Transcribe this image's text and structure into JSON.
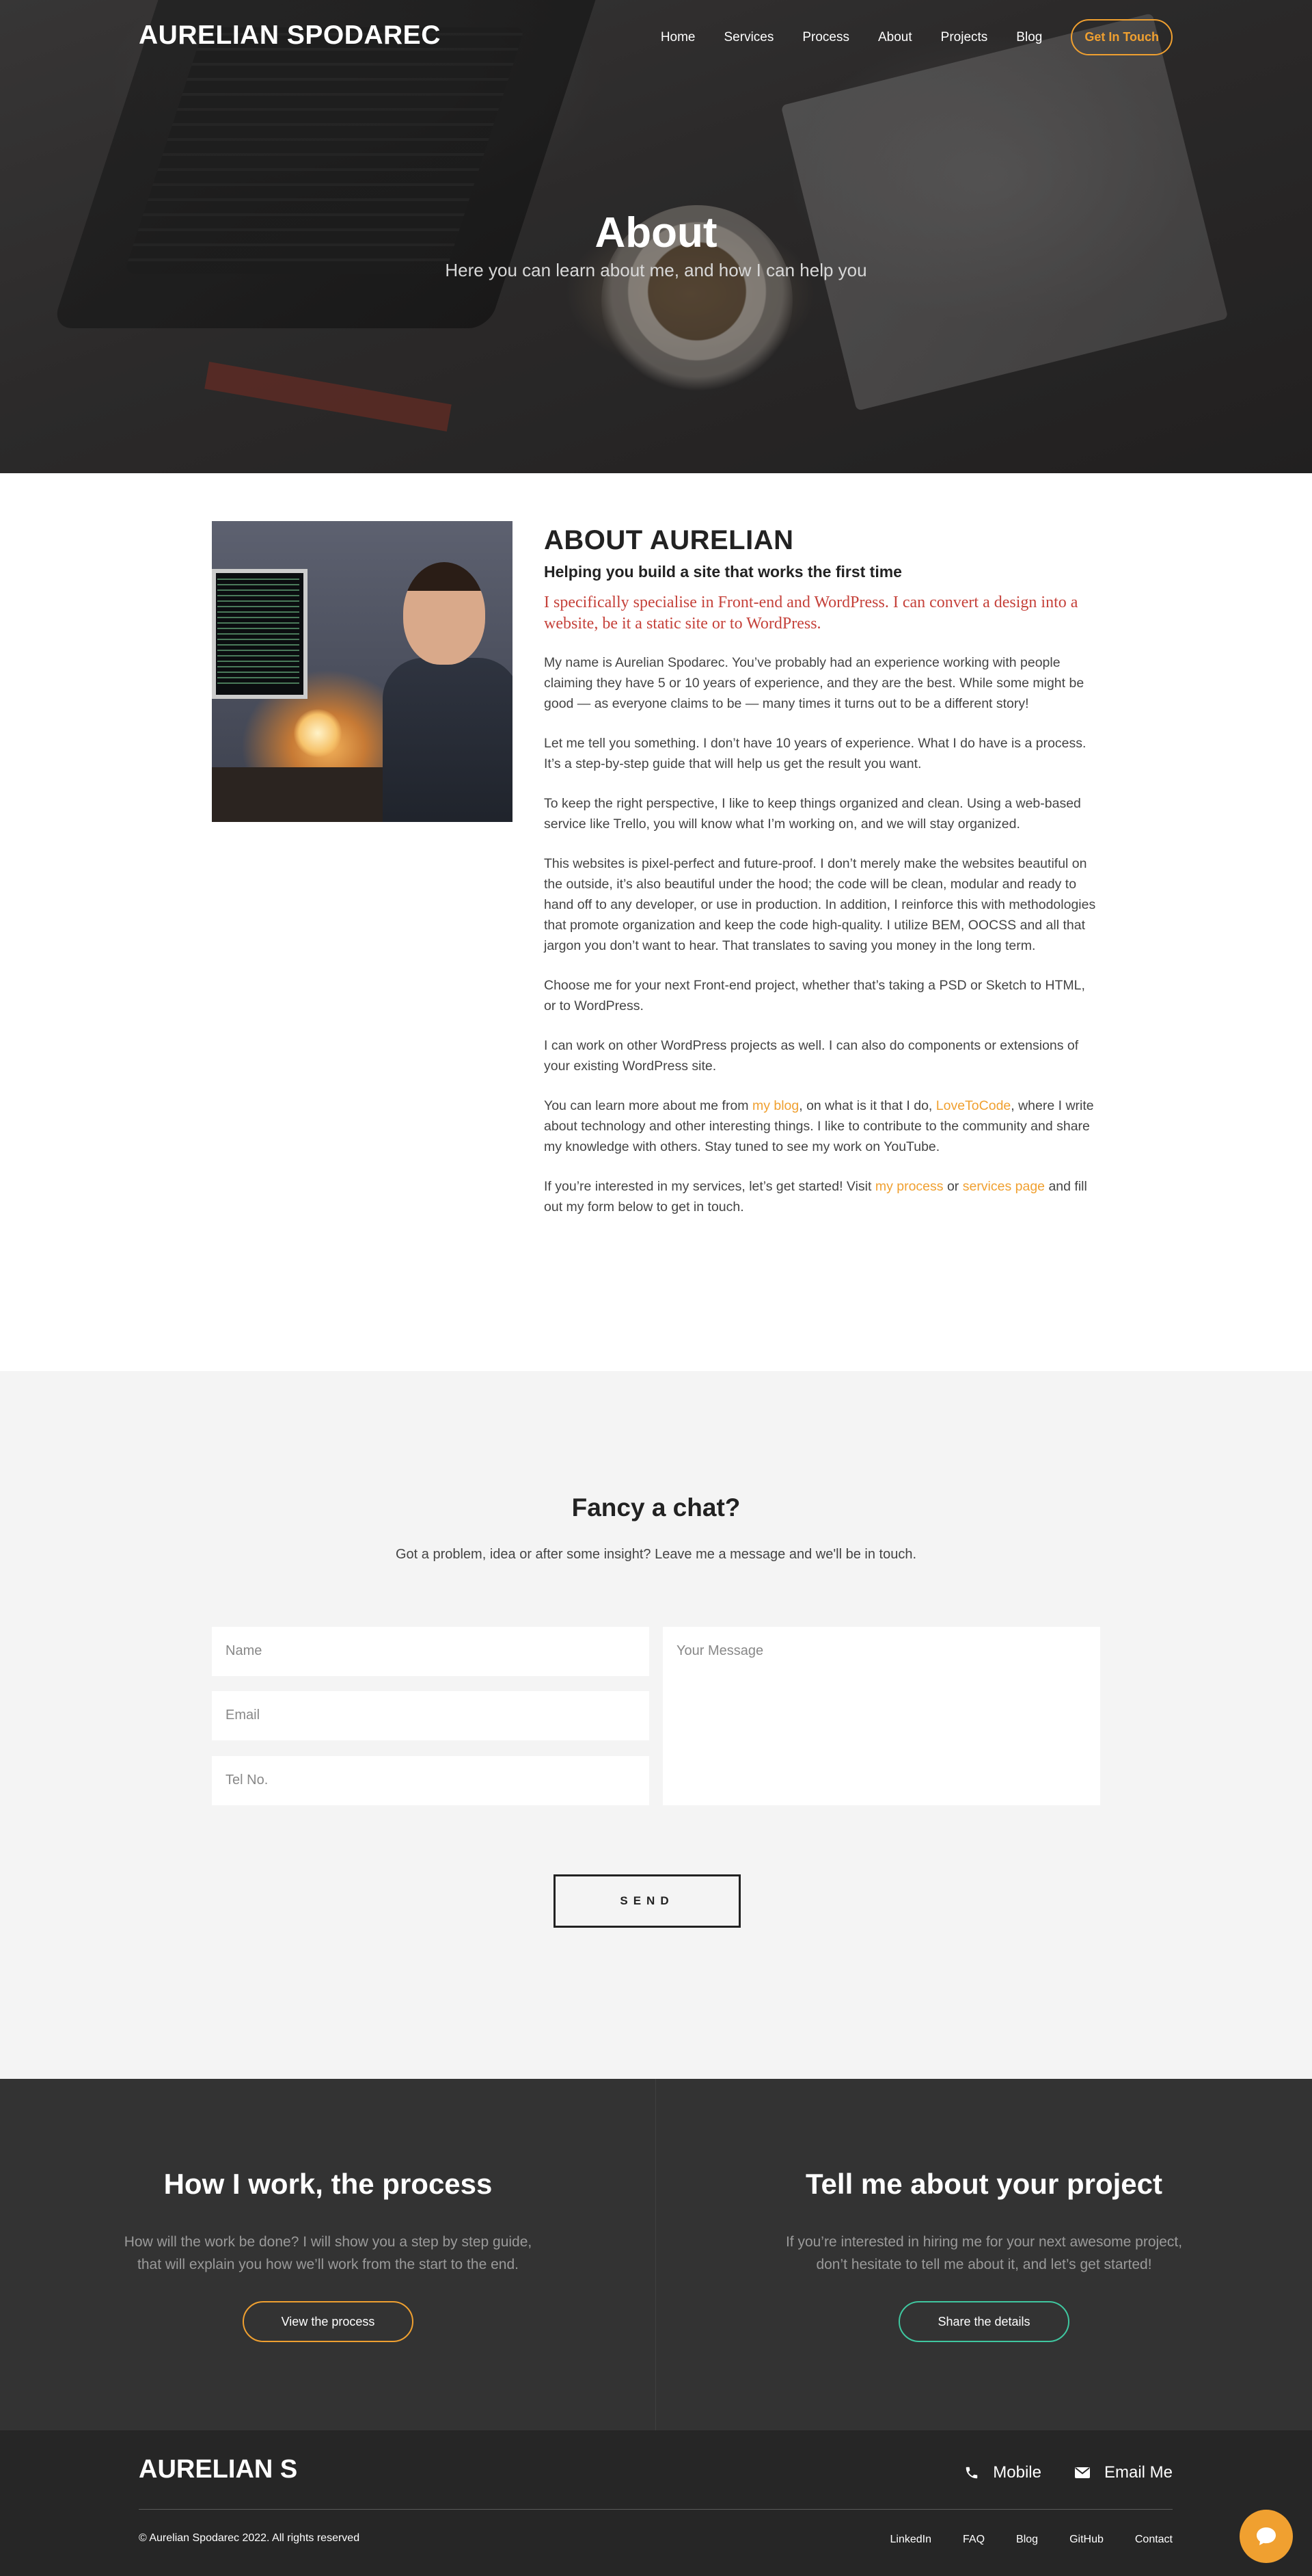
{
  "header": {
    "logo": "AURELIAN SPODAREC",
    "nav": [
      "Home",
      "Services",
      "Process",
      "About",
      "Projects",
      "Blog"
    ],
    "cta_label": "Get In Touch"
  },
  "hero": {
    "title": "About",
    "subtitle": "Here you can learn about me, and how I can help you"
  },
  "about": {
    "heading": "ABOUT AURELIAN",
    "subheading": "Helping you build a site that works the first time",
    "lead": "I specifically specialise in Front-end and WordPress. I can convert a design into a website, be it a static site or to WordPress.",
    "p1": "My name is Aurelian Spodarec. You’ve probably had an experience working with people claiming they have 5 or 10 years of experience, and they are the best. While some might be good — as everyone claims to be — many times it turns out to be a different story!",
    "p2": "Let me tell you something. I don’t have 10 years of experience. What I do have is a process. It’s a step-by-step guide that will help us get the result you want.",
    "p3": "To keep the right perspective, I like to keep things organized and clean. Using a web-based service like Trello, you will know what I’m working on, and we will stay organized.",
    "p4": "This websites is pixel-perfect and future-proof. I don’t merely make the websites beautiful on the outside, it’s also beautiful under the hood; the code will be clean, modular and ready to hand off to any developer, or use in production. In addition, I reinforce this with methodologies that promote organization and keep the code high-quality. I utilize BEM, OOCSS and all that jargon you don’t want to hear. That translates to saving you money in the long term.",
    "p5": "Choose me for your next Front-end project, whether that’s taking a PSD or Sketch to HTML, or to WordPress.",
    "p6": "I can work on other WordPress projects as well. I can also do components or extensions of your existing WordPress site.",
    "p7_a": "You can learn more about me from ",
    "p7_link1": "my blog",
    "p7_b": ", on what is it that I do, ",
    "p7_link2": "LoveToCode",
    "p7_c": ", where I write about technology and other interesting things. I like to contribute to the community and share my knowledge with others. Stay tuned to see my work on YouTube.",
    "p8_a": "If you’re interested in my services, let’s get started! Visit ",
    "p8_link1": "my process",
    "p8_b": " or ",
    "p8_link2": "services page",
    "p8_c": " and fill out my form below to get in touch."
  },
  "contact": {
    "title": "Fancy a chat?",
    "intro": "Got a problem, idea or after some insight? Leave me a message and we'll be in touch.",
    "name_placeholder": "Name",
    "email_placeholder": "Email",
    "tel_placeholder": "Tel No.",
    "message_placeholder": "Your Message",
    "send_label": "SEND"
  },
  "cta": {
    "left": {
      "title": "How I work, the process",
      "text_line1": "How will the work be done? I will show you a step by step guide,",
      "text_line2": "that will explain you how we’ll work from the start to the end.",
      "button": "View the process"
    },
    "right": {
      "title": "Tell me about your project",
      "text_line1": "If you’re interested in hiring me for your next awesome project,",
      "text_line2": "don’t hesitate to tell me about it, and let’s get started!",
      "button": "Share the details"
    }
  },
  "footer": {
    "logo": "AURELIAN S",
    "mobile_label": "Mobile",
    "email_label": "Email Me",
    "copyright": "© Aurelian Spodarec 2022. All rights reserved",
    "links": [
      "LinkedIn",
      "FAQ",
      "Blog",
      "GitHub",
      "Contact"
    ]
  },
  "colors": {
    "accent": "#f0a030",
    "lead_red": "#c5413a",
    "teal": "#3fc7a0",
    "dark_band": "#333333",
    "footer": "#262626"
  },
  "icons": [
    "phone-icon",
    "envelope-icon",
    "chat-bubble-icon"
  ]
}
